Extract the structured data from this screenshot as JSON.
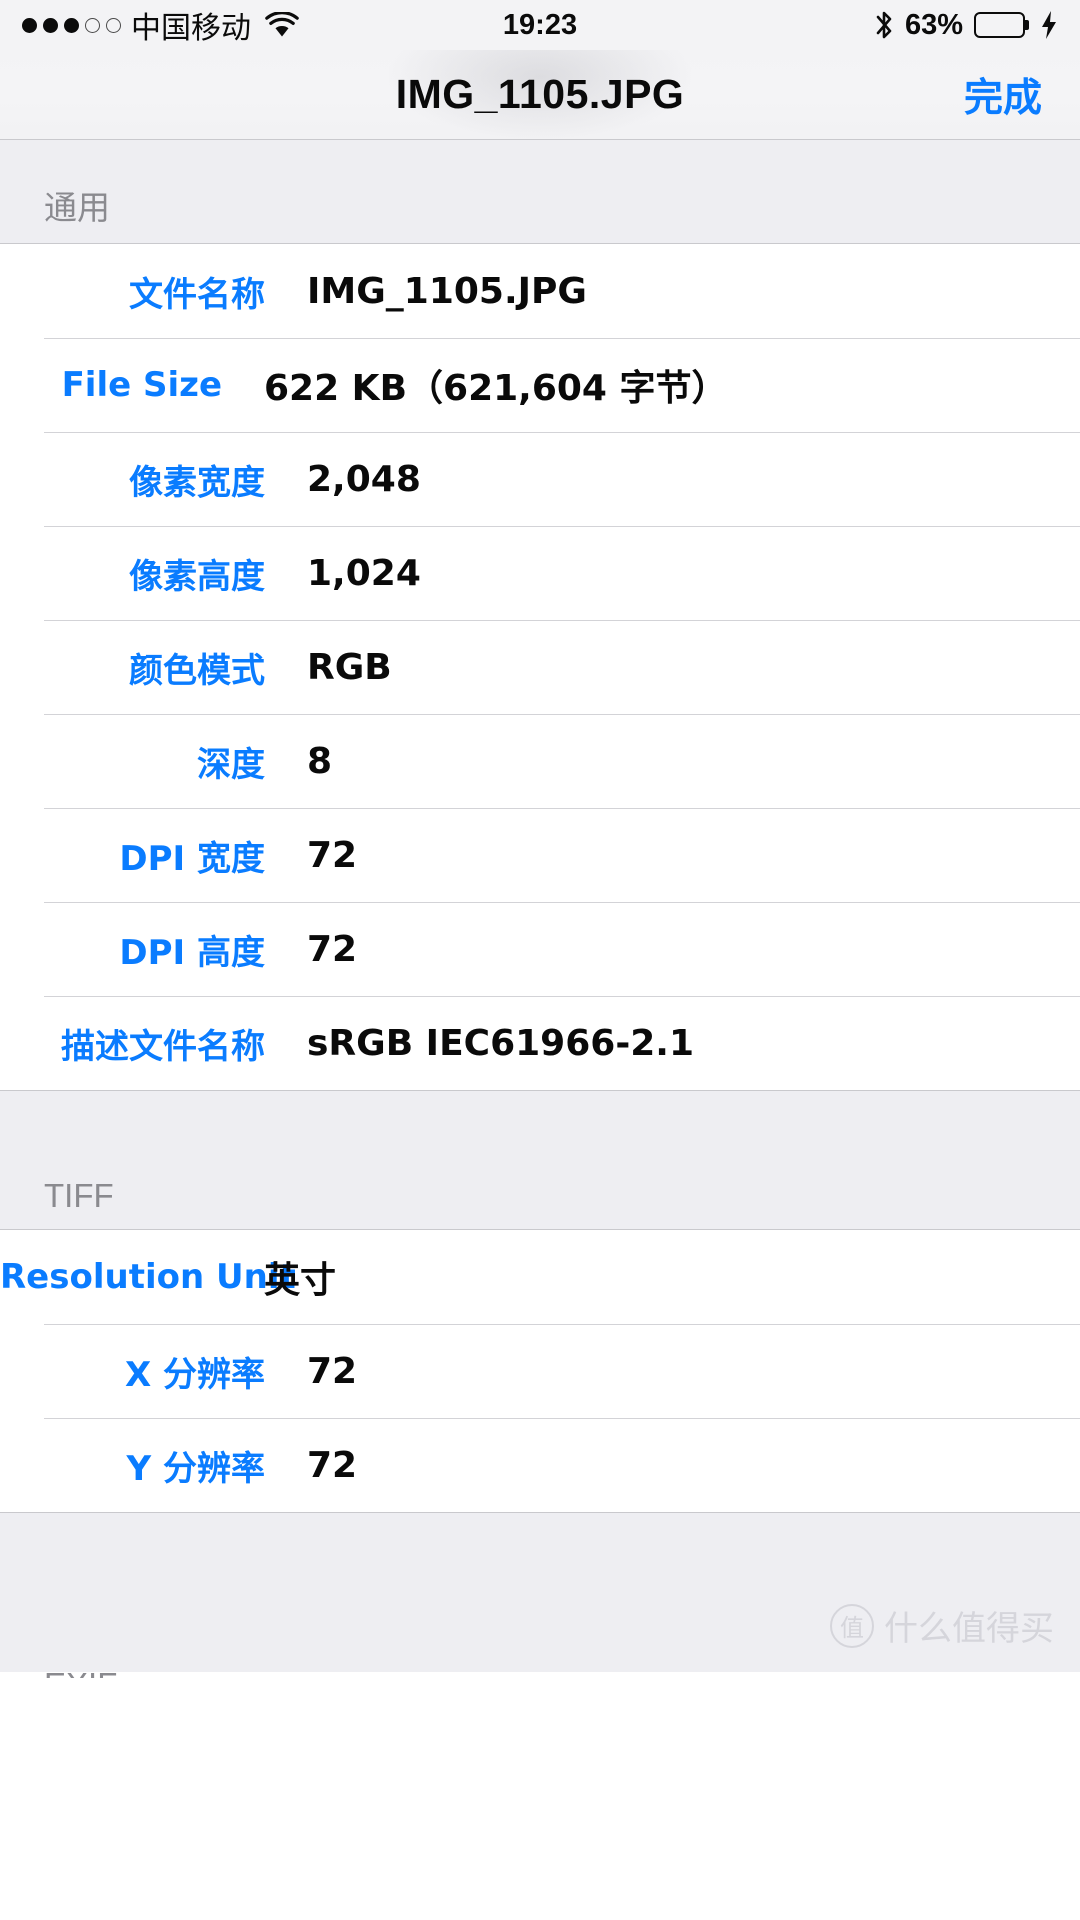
{
  "status_bar": {
    "signal_filled": 3,
    "signal_empty": 2,
    "carrier": "中国移动",
    "wifi_icon": "wifi-icon",
    "time": "19:23",
    "bluetooth_icon": "bluetooth-icon",
    "battery_percent": "63%",
    "battery_level": 63,
    "charging_icon": "lightning-bolt-icon",
    "battery_color": "#4cd663"
  },
  "nav": {
    "title": "IMG_1105.JPG",
    "done_label": "完成",
    "accent_color": "#0a7cff"
  },
  "sections": [
    {
      "header": "通用",
      "rows": [
        {
          "label": "文件名称",
          "value": "IMG_1105.JPG"
        },
        {
          "label": "File Size",
          "value": "622 KB（621,604 字节）"
        },
        {
          "label": "像素宽度",
          "value": "2,048"
        },
        {
          "label": "像素高度",
          "value": "1,024"
        },
        {
          "label": "颜色模式",
          "value": "RGB"
        },
        {
          "label": "深度",
          "value": "8"
        },
        {
          "label": "DPI 宽度",
          "value": "72"
        },
        {
          "label": "DPI 高度",
          "value": "72"
        },
        {
          "label": "描述文件名称",
          "value": "sRGB IEC61966-2.1"
        }
      ]
    },
    {
      "header": "TIFF",
      "rows": [
        {
          "label": "Resolution Unit",
          "value": "英寸"
        },
        {
          "label": "X 分辨率",
          "value": "72"
        },
        {
          "label": "Y 分辨率",
          "value": "72"
        }
      ]
    }
  ],
  "footer": {
    "next_section_partial": "EXIF",
    "watermark_badge": "值",
    "watermark_text": "什么值得买"
  }
}
